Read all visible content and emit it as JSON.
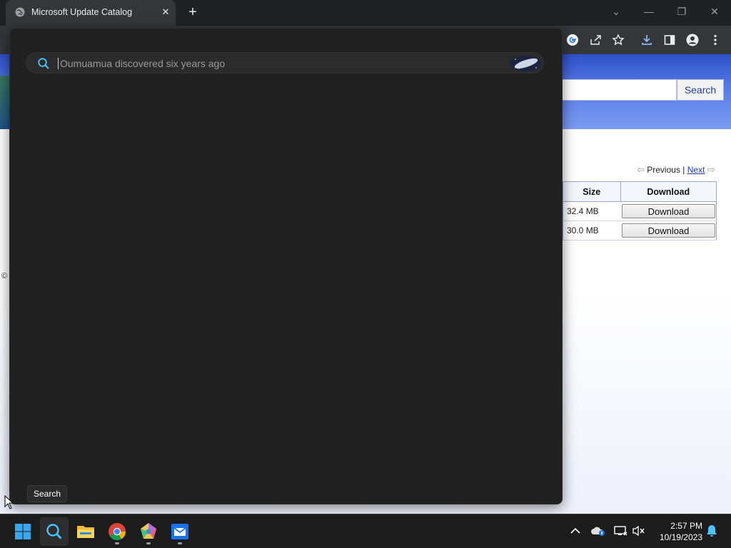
{
  "browser": {
    "tab_title": "Microsoft Update Catalog",
    "tab_close": "✕",
    "new_tab": "+",
    "window_controls": {
      "tab_search": "⌄",
      "minimize": "—",
      "restore": "❐",
      "close": "✕"
    },
    "toolbar_icons": [
      "google-icon",
      "share-icon",
      "star-icon",
      "download-icon",
      "side-panel-icon",
      "profile-icon",
      "menu-icon"
    ]
  },
  "page": {
    "search_button": "Search",
    "pager": {
      "previous": "Previous",
      "separator": "|",
      "next": "Next"
    },
    "table": {
      "headers": {
        "size": "Size",
        "download": "Download"
      },
      "rows": [
        {
          "size": "32.4 MB",
          "download": "Download"
        },
        {
          "size": "30.0 MB",
          "download": "Download"
        }
      ]
    },
    "copyright": "©"
  },
  "search_flyout": {
    "placeholder": "Oumuamua discovered six years ago",
    "tooltip": "Search"
  },
  "taskbar": {
    "apps": [
      "start-icon",
      "search-icon",
      "file-explorer-icon",
      "chrome-icon",
      "app-icon",
      "mail-icon"
    ],
    "clock": {
      "time": "2:57 PM",
      "date": "10/19/2023"
    }
  },
  "colors": {
    "flyout_bg": "#202020",
    "taskbar_bg": "#1c1c1c",
    "chrome_dark": "#202124",
    "banner_blue": "#2d50c8",
    "link_blue": "#1c3fb3"
  }
}
